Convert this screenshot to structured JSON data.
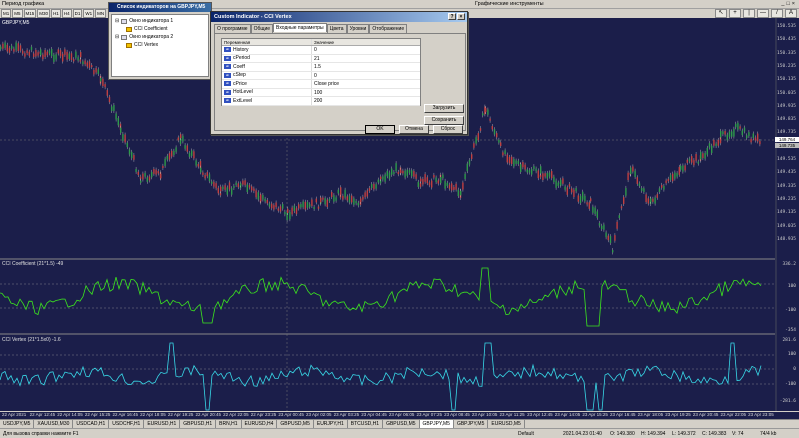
{
  "app": {
    "period_label": "Период графика",
    "tools_label": "Графические инструменты",
    "timeframes": [
      "M1",
      "M5",
      "M15",
      "M30",
      "H1",
      "H4",
      "D1",
      "W1",
      "MN"
    ],
    "window_buttons": [
      "_",
      "□",
      "×"
    ]
  },
  "chart": {
    "symbol": "GBPJPY,M5",
    "price_labels": [
      "150.535",
      "150.435",
      "150.335",
      "150.235",
      "150.135",
      "150.035",
      "149.935",
      "149.835",
      "149.735",
      "149.635",
      "149.535",
      "149.435",
      "149.335",
      "149.235",
      "149.135",
      "149.035",
      "148.935"
    ],
    "current_price": "149.764",
    "current_price2": "149.735",
    "sub1_label": "CCI Coefficient (21*1.5) -49",
    "sub1_axis": [
      "336.2",
      "100",
      "-100",
      "-354"
    ],
    "sub2_label": "CCI Vertex (21*1.5x0) -1.6",
    "sub2_axis": [
      "281.6",
      "100",
      "0",
      "-100",
      "-281.6"
    ],
    "time_labels": [
      "22 Apr 2021",
      "22 Apr 12:05",
      "22 Apr 12:45",
      "22 Apr 13:25",
      "22 Apr 14:05",
      "22 Apr 14:45",
      "22 Apr 15:25",
      "22 Apr 16:05",
      "22 Apr 16:45",
      "22 Apr 17:25",
      "22 Apr 18:05",
      "22 Apr 18:45",
      "22 Apr 19:25",
      "22 Apr 20:05",
      "22 Apr 20:45",
      "22 Apr 21:25",
      "22 Apr 22:05",
      "22 Apr 22:45",
      "22 Apr 23:25",
      "23 Apr 00:05",
      "23 Apr 00:45",
      "23 Apr 01:25",
      "23 Apr 02:05",
      "23 Apr 02:45",
      "23 Apr 03:25",
      "23 Apr 04:05",
      "23 Apr 04:45",
      "23 Apr 05:25",
      "23 Apr 06:05",
      "23 Apr 06:45",
      "23 Apr 07:25",
      "23 Apr 08:05",
      "23 Apr 08:45",
      "23 Apr 09:25",
      "23 Apr 10:05",
      "23 Apr 10:45",
      "23 Apr 11:25",
      "23 Apr 12:05",
      "23 Apr 12:45",
      "23 Apr 13:25",
      "23 Apr 14:05",
      "23 Apr 14:45",
      "23 Apr 15:25",
      "23 Apr 16:05",
      "23 Apr 16:45",
      "23 Apr 17:25",
      "23 Apr 18:05",
      "23 Apr 18:45",
      "23 Apr 19:25",
      "23 Apr 20:05",
      "23 Apr 20:45",
      "23 Apr 21:25",
      "23 Apr 22:05",
      "23 Apr 22:45",
      "23 Apr 23:05"
    ]
  },
  "indicator_list": {
    "title": "Список индикаторов на GBPJPY,M5",
    "window1": "Окно индикатора 1",
    "item1": "CCI Coefficient",
    "window2": "Окно индикатора 2",
    "item2": "CCI Vertex"
  },
  "dialog": {
    "title": "Custom Indicator - CCI Vertex",
    "help": "?",
    "close": "×",
    "tabs": [
      "О программе",
      "Общие",
      "Входные параметры",
      "Цвета",
      "Уровни",
      "Отображение"
    ],
    "active_tab": 2,
    "col_variable": "Переменная",
    "col_value": "Значение",
    "params": [
      {
        "name": "History",
        "value": "0"
      },
      {
        "name": "cPeriod",
        "value": "21"
      },
      {
        "name": "Coeff",
        "value": "1.5"
      },
      {
        "name": "cStep",
        "value": "0"
      },
      {
        "name": "cPrice",
        "value": "Close price"
      },
      {
        "name": "HotLevel",
        "value": "100"
      },
      {
        "name": "ExtLevel",
        "value": "200"
      }
    ],
    "load_button": "Загрузить",
    "save_button": "Сохранить",
    "ok_button": "OK",
    "cancel_button": "Отмена",
    "reset_button": "Сброс"
  },
  "tabs": [
    "USDJPY,M5",
    "XAUUSD,M30",
    "USDCAD,H1",
    "USDCHF,H1",
    "EURUSD,H1",
    "GBPUSD,H1",
    "BRN,H1",
    "EURUSD,H4",
    "GBPUSD,M5",
    "EURJPY,H1",
    "BTCUSD,H1",
    "GBPUSD,M5",
    "GBPJPY,M5",
    "GBPJPY,M5",
    "EURUSD,M5"
  ],
  "active_tab_index": 12,
  "status": {
    "help": "Для вызова справки нажмите F1",
    "profile": "Default",
    "datetime": "2021.04.23 01:40",
    "open": "O: 149.380",
    "high": "H: 149.394",
    "low": "L: 149.372",
    "close": "C: 149.383",
    "volume": "V: 74",
    "traffic": "74/4 kb"
  }
}
